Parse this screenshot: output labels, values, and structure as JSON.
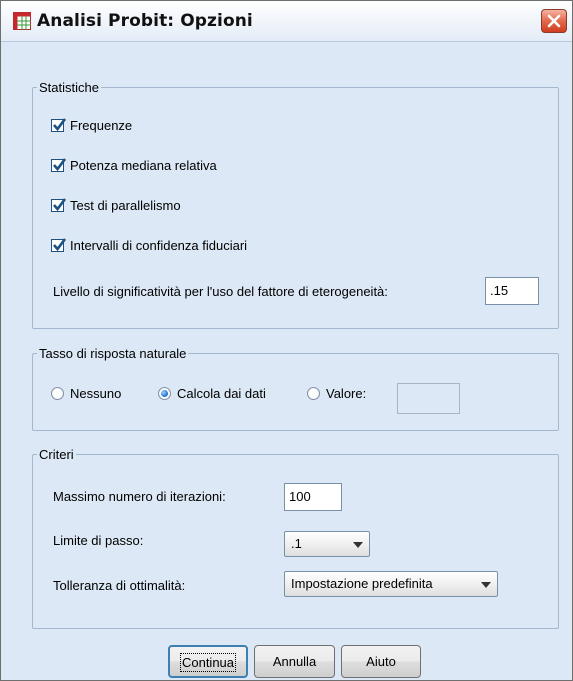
{
  "window": {
    "title": "Analisi Probit: Opzioni"
  },
  "statistiche": {
    "legend": "Statistiche",
    "items": [
      {
        "label": "Frequenze",
        "checked": true
      },
      {
        "label": "Potenza mediana relativa",
        "checked": true
      },
      {
        "label": "Test di parallelismo",
        "checked": true
      },
      {
        "label": "Intervalli di confidenza fiduciari",
        "checked": true
      }
    ],
    "eterogeneita_label": "Livello di significatività per l'uso del fattore di eterogeneità:",
    "eterogeneita_value": ".15"
  },
  "tasso": {
    "legend": "Tasso di risposta naturale",
    "options": [
      {
        "label": "Nessuno",
        "selected": false
      },
      {
        "label": "Calcola dai dati",
        "selected": true
      },
      {
        "label": "Valore:",
        "selected": false
      }
    ],
    "valore_value": ""
  },
  "criteri": {
    "legend": "Criteri",
    "iterazioni_label": "Massimo numero di iterazioni:",
    "iterazioni_value": "100",
    "passo_label": "Limite di passo:",
    "passo_value": ".1",
    "tolleranza_label": "Tolleranza di ottimalità:",
    "tolleranza_value": "Impostazione predefinita"
  },
  "buttons": {
    "continua": "Continua",
    "annulla": "Annulla",
    "aiuto": "Aiuto"
  },
  "icons": {
    "app": "spreadsheet-grid-icon",
    "close": "close-x-icon"
  },
  "colors": {
    "dialog_bg": "#dce8f5",
    "check_accent": "#1c5180",
    "close_red": "#d9472b"
  }
}
